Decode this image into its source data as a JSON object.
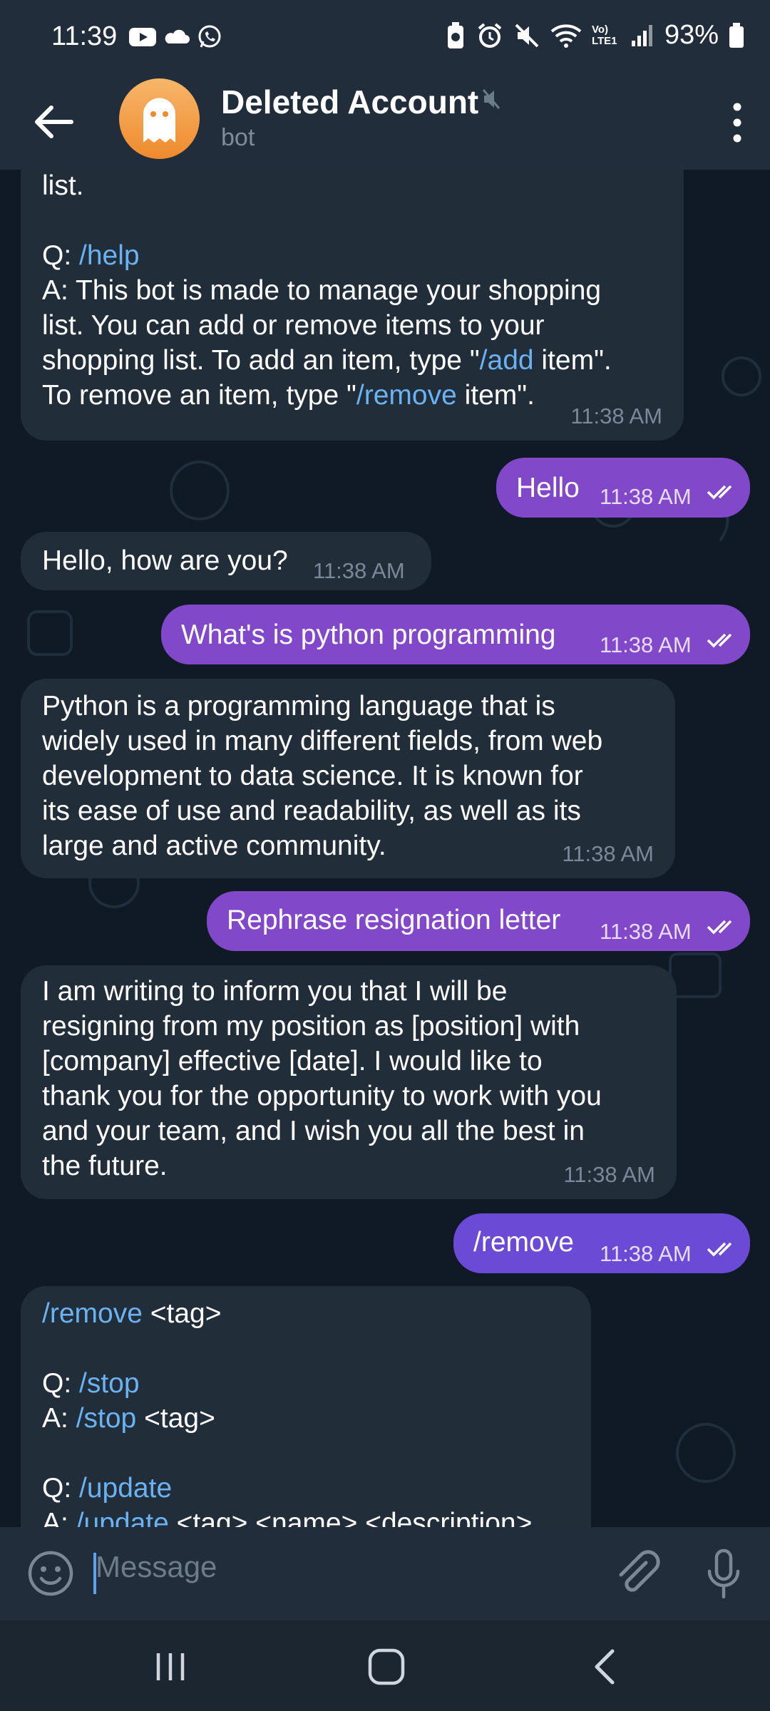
{
  "status_bar": {
    "time": "11:39",
    "battery": "93%",
    "network": "Vo) LTE1"
  },
  "header": {
    "title": "Deleted Account",
    "subtitle": "bot"
  },
  "messages": [
    {
      "dir": "in",
      "time": "11:38 AM",
      "top_text": "list.",
      "q1": "Q:",
      "q1_cmd": "/help",
      "a_lines": [
        "A: This bot is made to manage your shopping",
        "list. You can add or remove items to your"
      ],
      "a_line3_pre": "shopping list. To add an item, type \"",
      "a_line3_cmd": "/add",
      "a_line3_post": " item\".",
      "a_line4_pre": "To remove an item, type \"",
      "a_line4_cmd": "/remove",
      "a_line4_post": " item\"."
    },
    {
      "dir": "out",
      "text": "Hello",
      "time": "11:38 AM"
    },
    {
      "dir": "in",
      "text": "Hello, how are you?",
      "time": "11:38 AM"
    },
    {
      "dir": "out",
      "text": "What's is python programming",
      "time": "11:38 AM"
    },
    {
      "dir": "in",
      "time": "11:38 AM",
      "lines": [
        "Python is a programming language that is",
        "widely used in many different fields, from web",
        "development to data science. It is known for",
        "its ease of use and readability, as well as its",
        "large and active community."
      ]
    },
    {
      "dir": "out",
      "text": "Rephrase resignation letter",
      "time": "11:38 AM"
    },
    {
      "dir": "in",
      "time": "11:38 AM",
      "lines": [
        "I am writing to inform you that I will be",
        "resigning from my position as [position] with",
        "[company] effective [date]. I would like to",
        "thank you for the opportunity to work with you",
        "and your team, and I wish you all the best in",
        "the future."
      ]
    },
    {
      "dir": "out",
      "text": "/remove",
      "time": "11:38 AM"
    },
    {
      "dir": "in",
      "l1_cmd": "/remove",
      "l1_post": " <tag>",
      "q2": "Q: ",
      "q2_cmd": "/stop",
      "a2": "A: ",
      "a2_cmd": "/stop",
      "a2_post": " <tag>",
      "q3": "Q: ",
      "q3_cmd": "/update",
      "a3": "A: ",
      "a3_cmd": "/update",
      "a3_post": " <tag> <name> <description>"
    }
  ],
  "composer": {
    "placeholder": "Message"
  },
  "colors": {
    "header_bg": "#212d3b",
    "incoming": "#222d3a",
    "outgoing": "#8148c9",
    "link": "#6ab2f2"
  }
}
